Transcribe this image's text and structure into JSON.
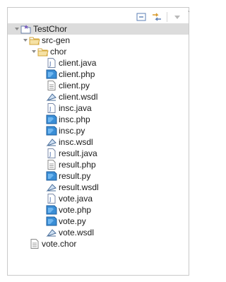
{
  "explorer": {
    "toolbar": [
      {
        "name": "collapse-all-icon"
      },
      {
        "name": "link-with-editor-icon"
      },
      {
        "name": "view-menu-icon"
      }
    ],
    "tree": [
      {
        "label": "TestChor",
        "depth": 0,
        "kind": "project",
        "expanded": true
      },
      {
        "label": "src-gen",
        "depth": 1,
        "kind": "folder",
        "expanded": true
      },
      {
        "label": "chor",
        "depth": 2,
        "kind": "folder",
        "expanded": true
      },
      {
        "label": "client.java",
        "depth": 3,
        "kind": "java"
      },
      {
        "label": "client.php",
        "depth": 3,
        "kind": "php"
      },
      {
        "label": "client.py",
        "depth": 3,
        "kind": "text"
      },
      {
        "label": "client.wsdl",
        "depth": 3,
        "kind": "wsdl"
      },
      {
        "label": "insc.java",
        "depth": 3,
        "kind": "java"
      },
      {
        "label": "insc.php",
        "depth": 3,
        "kind": "php"
      },
      {
        "label": "insc.py",
        "depth": 3,
        "kind": "php"
      },
      {
        "label": "insc.wsdl",
        "depth": 3,
        "kind": "wsdl"
      },
      {
        "label": "result.java",
        "depth": 3,
        "kind": "java"
      },
      {
        "label": "result.php",
        "depth": 3,
        "kind": "text"
      },
      {
        "label": "result.py",
        "depth": 3,
        "kind": "php"
      },
      {
        "label": "result.wsdl",
        "depth": 3,
        "kind": "wsdl"
      },
      {
        "label": "vote.java",
        "depth": 3,
        "kind": "java"
      },
      {
        "label": "vote.php",
        "depth": 3,
        "kind": "php"
      },
      {
        "label": "vote.py",
        "depth": 3,
        "kind": "php"
      },
      {
        "label": "vote.wsdl",
        "depth": 3,
        "kind": "wsdl"
      },
      {
        "label": "vote.chor",
        "depth": 1,
        "kind": "text"
      }
    ]
  }
}
